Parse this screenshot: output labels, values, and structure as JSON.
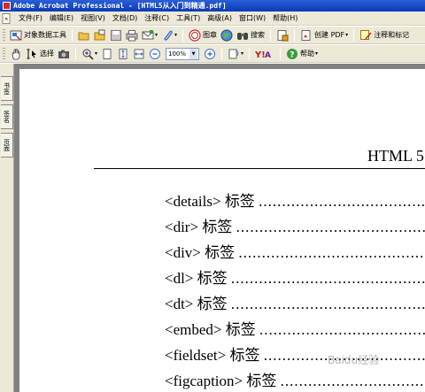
{
  "window": {
    "title": "Adobe Acrobat Professional - [HTML5从入门到精通.pdf]"
  },
  "menu": [
    "文件(F)",
    "编辑(E)",
    "视图(V)",
    "文档(D)",
    "注释(C)",
    "工具(T)",
    "高级(A)",
    "窗口(W)",
    "帮助(H)"
  ],
  "toolbar1": {
    "object_data_tool": "对象数据工具",
    "stamp": "图章",
    "search": "搜索",
    "create_pdf": "创建 PDF",
    "comment_markup": "注释和标记"
  },
  "toolbar2": {
    "select": "选择",
    "zoom_value": "100%",
    "help": "帮助"
  },
  "nav_tabs": {
    "bookmarks": "书签",
    "signatures": "签名",
    "pages": "页面"
  },
  "document": {
    "header": "HTML 5",
    "toc": [
      {
        "tag": "<details>",
        "word": "标签"
      },
      {
        "tag": "<dir>",
        "word": "标签"
      },
      {
        "tag": "<div>",
        "word": "标签"
      },
      {
        "tag": "<dl>",
        "word": "标签"
      },
      {
        "tag": "<dt>",
        "word": "标签"
      },
      {
        "tag": "<embed>",
        "word": "标签"
      },
      {
        "tag": "<fieldset>",
        "word": "标签"
      },
      {
        "tag": "<figcaption>",
        "word": "标签"
      }
    ],
    "dots": "..............................................."
  },
  "watermark": "Baidu经验",
  "colors": {
    "titlebar": "#0a3ab8",
    "chrome": "#ece9d8",
    "workspace": "#808080"
  }
}
